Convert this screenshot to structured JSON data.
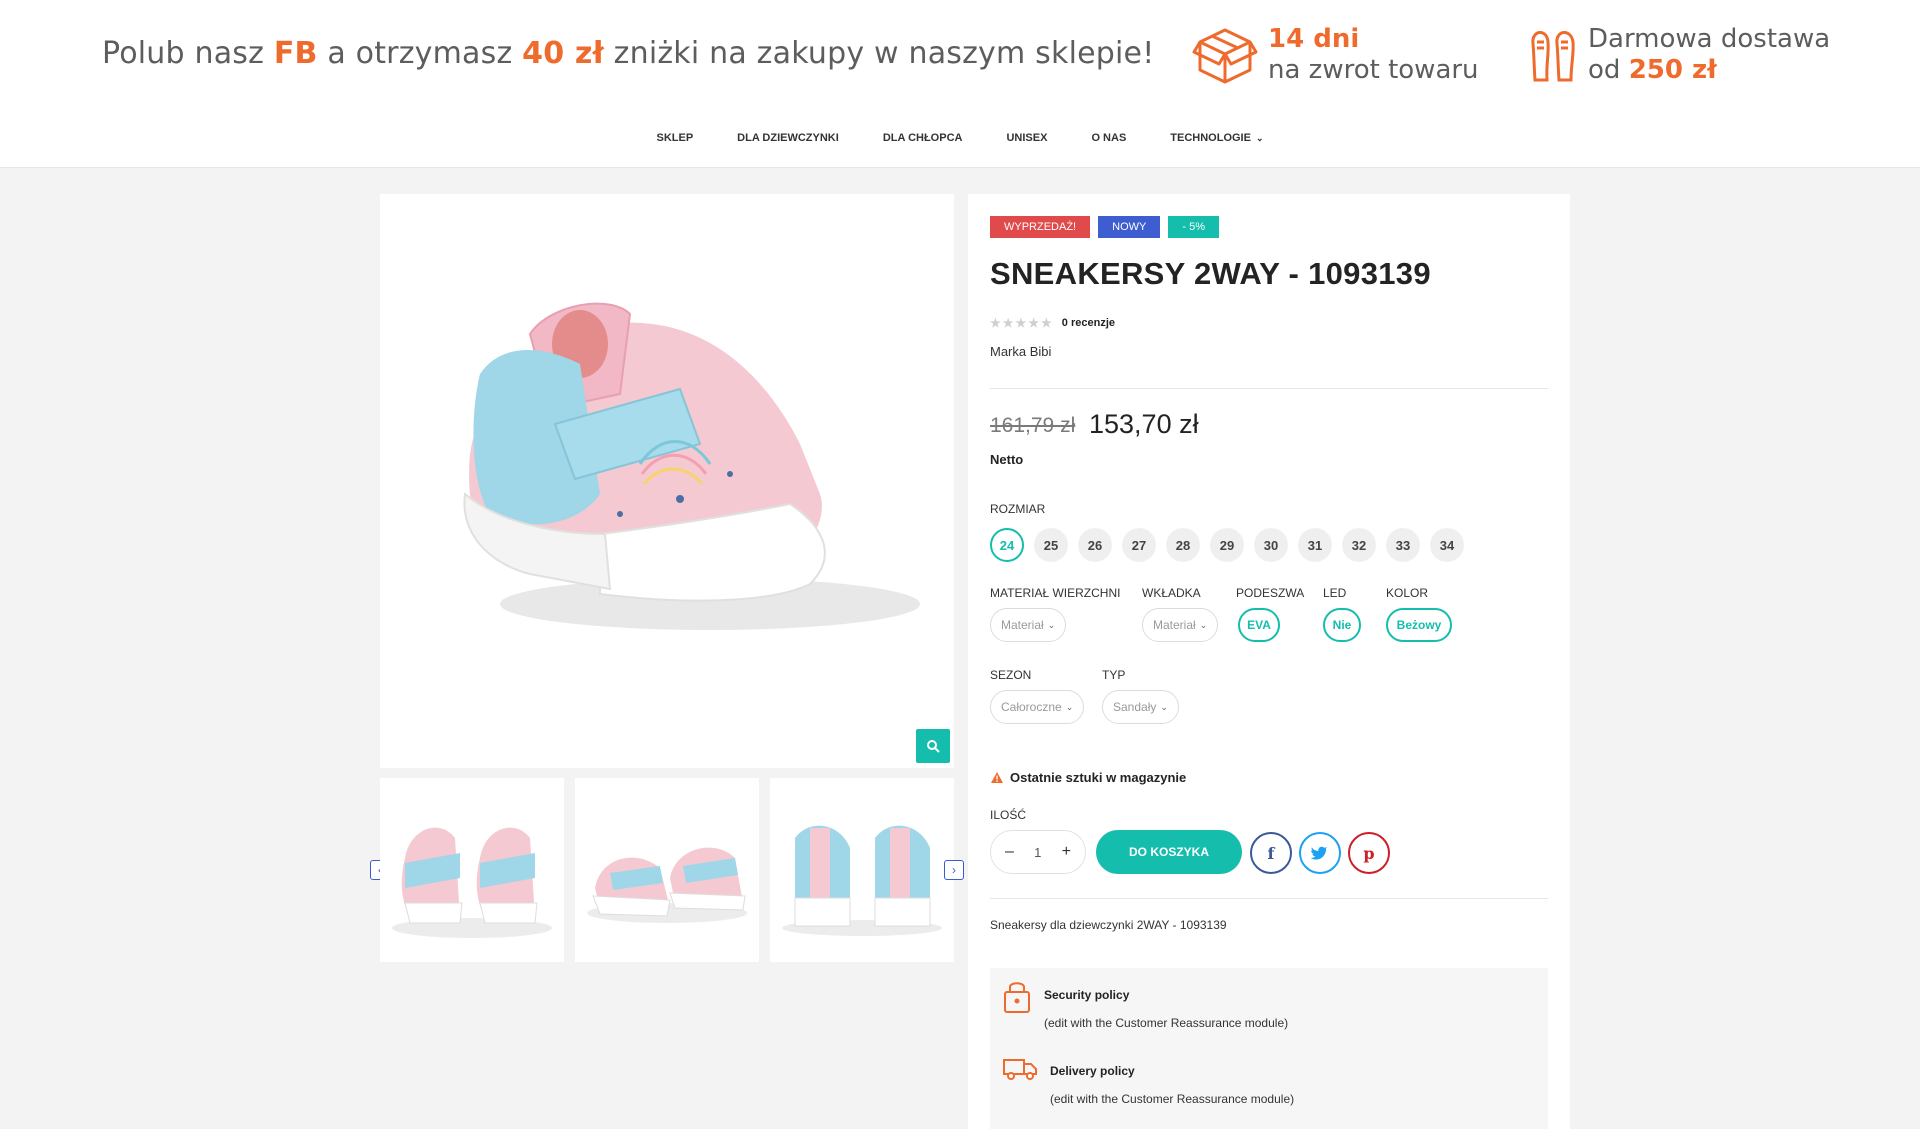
{
  "promo": {
    "p1": "Polub nasz ",
    "fb": "FB",
    "p2": " a otrzymasz ",
    "amount": "40 zł",
    "p3": " zniżki na zakupy w naszym sklepie!"
  },
  "returns": {
    "line1": "14 dni",
    "line2": "na zwrot towaru"
  },
  "delivery": {
    "line1": "Darmowa dostawa",
    "line2_prefix": "od ",
    "line2_amount": "250 zł"
  },
  "nav": [
    "SKLEP",
    "DLA DZIEWCZYNKI",
    "DLA CHŁOPCA",
    "UNISEX",
    "O NAS",
    "TECHNOLOGIE"
  ],
  "product": {
    "badges": {
      "sale": "WYPRZEDAŻ!",
      "new": "NOWY",
      "discount": "- 5%"
    },
    "title": "SNEAKERSY 2WAY - 1093139",
    "reviews": "0 recenzje",
    "brand": "Marka Bibi",
    "old_price": "161,79 zł",
    "price": "153,70 zł",
    "netto": "Netto",
    "rating_value": 0,
    "rating_max": 5,
    "size_label": "ROZMIAR",
    "sizes": [
      "24",
      "25",
      "26",
      "27",
      "28",
      "29",
      "30",
      "31",
      "32",
      "33",
      "34"
    ],
    "selected_size": "24",
    "attributes": {
      "material_label": "MATERIAŁ WIERZCHNI",
      "material_value": "Materiał",
      "insole_label": "WKŁADKA",
      "insole_value": "Materiał",
      "sole_label": "PODESZWA",
      "sole_value": "EVA",
      "led_label": "LED",
      "led_value": "Nie",
      "color_label": "KOLOR",
      "color_value": "Beżowy",
      "season_label": "SEZON",
      "season_value": "Całoroczne",
      "type_label": "TYP",
      "type_value": "Sandały"
    },
    "stock": "Ostatnie sztuki w magazynie",
    "qty_label": "ILOŚĆ",
    "qty": "1",
    "qty_minus": "–",
    "qty_plus": "+",
    "cart_btn": "DO KOSZYKA",
    "description": "Sneakersy dla dziewczynki 2WAY - 1093139"
  },
  "reassurance": [
    {
      "title": "Security policy",
      "sub": "(edit with the Customer Reassurance module)"
    },
    {
      "title": "Delivery policy",
      "sub": "(edit with the Customer Reassurance module)"
    }
  ],
  "colors": {
    "accent": "#14bdac",
    "orange": "#ef6a2d",
    "sale": "#e04a4a",
    "new": "#3d5dd1"
  }
}
